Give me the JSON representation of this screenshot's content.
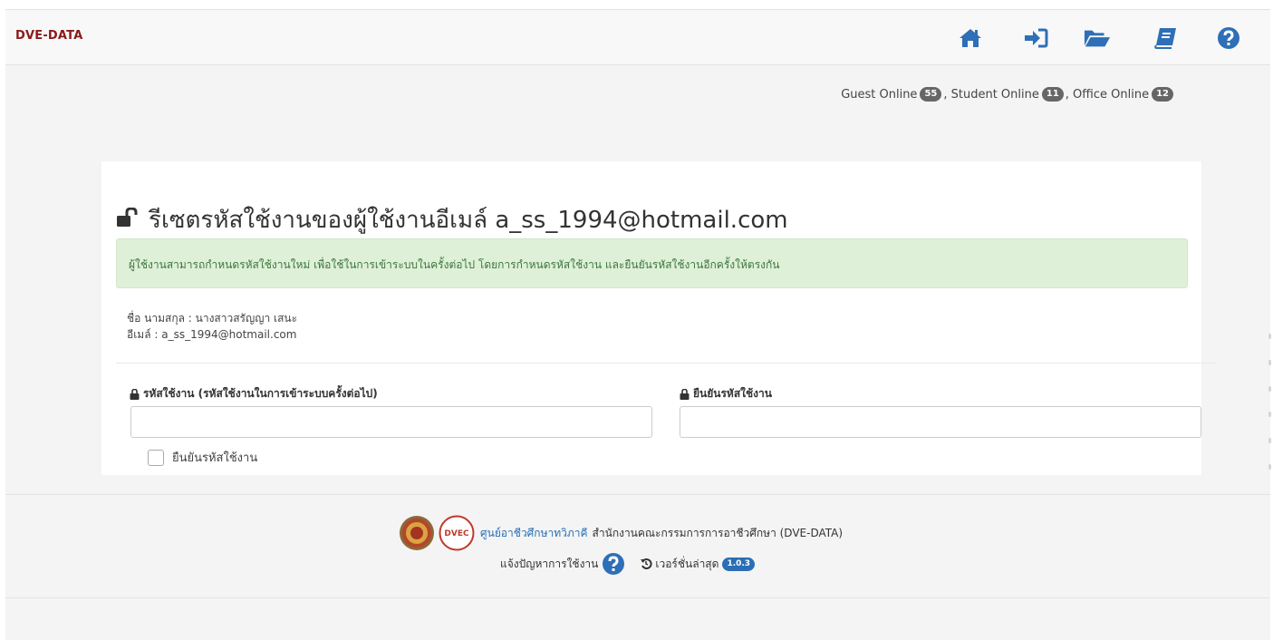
{
  "navbar": {
    "brand": "DVE-DATA",
    "icons": [
      "home-icon",
      "sign-in-icon",
      "folder-open-icon",
      "book-icon",
      "question-circle-icon"
    ],
    "icon_color": "#2e6fb7"
  },
  "online": {
    "guest_label": "Guest Online",
    "guest_count": "55",
    "student_label": ", Student Online",
    "student_count": "11",
    "office_label": ", Office Online",
    "office_count": "12"
  },
  "panel": {
    "title": "รีเซตรหัสใช้งานของผู้ใช้งานอีเมล์ a_ss_1994@hotmail.com",
    "alert": "ผู้ใช้งานสามารถกำหนดรหัสใช้งานใหม่ เพื่อใช้ในการเข้าระบบในครั้งต่อไป โดยการกำหนดรหัสใช้งาน และยืนยันรหัสใช้งานอีกครั้งให้ตรงกัน",
    "name_line": "ชื่อ นามสกุล : นางสาวสรัญญา เสนะ",
    "email_line": "อีเมล์ : a_ss_1994@hotmail.com",
    "password_label": "รหัสใช้งาน (รหัสใช้งานในการเข้าระบบครั้งต่อไป)",
    "password_value": "",
    "confirm_label": "ยืนยันรหัสใช้งาน",
    "confirm_value": "",
    "checkbox_label": "ยืนยันรหัสใช้งาน",
    "alert_bg": "#dff0d8",
    "alert_text_color": "#3c763d"
  },
  "footer": {
    "center_link": "ศูนย์อาชีวศึกษาทวิภาคี",
    "org_text": "สำนักงานคณะกรรมการการอาชีวศึกษา (DVE-DATA)",
    "report_label": "แจ้งปัญหาการใช้งาน",
    "version_label": "เวอร์ชั่นล่าสุด",
    "version_number": "1.0.3",
    "dvec_logo_text": "DVEC"
  }
}
